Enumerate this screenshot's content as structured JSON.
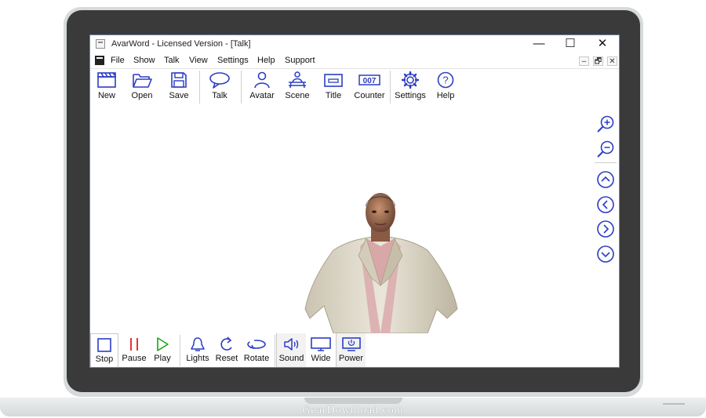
{
  "window": {
    "title": "AvarWord - Licensed Version - [Talk]",
    "controls": {
      "minimize": "—",
      "maximize": "☐",
      "close": "✕"
    },
    "mdi_controls": {
      "minimize": "–",
      "restore": "🗗",
      "close": "✕"
    }
  },
  "menu": [
    "File",
    "Show",
    "Talk",
    "View",
    "Settings",
    "Help",
    "Support"
  ],
  "toolbar": [
    {
      "label": "New",
      "icon": "clapperboard-icon"
    },
    {
      "label": "Open",
      "icon": "folder-open-icon"
    },
    {
      "label": "Save",
      "icon": "floppy-disk-icon"
    },
    {
      "label": "Talk",
      "icon": "speech-bubble-icon"
    },
    {
      "label": "Avatar",
      "icon": "person-icon"
    },
    {
      "label": "Scene",
      "icon": "scene-icon"
    },
    {
      "label": "Title",
      "icon": "title-card-icon"
    },
    {
      "label": "Counter",
      "icon": "counter-icon"
    },
    {
      "label": "Settings",
      "icon": "gear-icon"
    },
    {
      "label": "Help",
      "icon": "question-circle-icon"
    }
  ],
  "nav_controls": [
    "zoom-in-icon",
    "zoom-out-icon",
    "arrow-up-icon",
    "arrow-left-icon",
    "arrow-right-icon",
    "arrow-down-icon"
  ],
  "bottom_toolbar": [
    {
      "label": "Stop",
      "icon": "stop-icon"
    },
    {
      "label": "Pause",
      "icon": "pause-icon"
    },
    {
      "label": "Play",
      "icon": "play-icon"
    },
    {
      "label": "Lights",
      "icon": "bell-light-icon"
    },
    {
      "label": "Reset",
      "icon": "reset-icon"
    },
    {
      "label": "Rotate",
      "icon": "rotate-icon"
    },
    {
      "label": "Sound",
      "icon": "speaker-icon"
    },
    {
      "label": "Wide",
      "icon": "monitor-icon"
    },
    {
      "label": "Power",
      "icon": "power-icon"
    }
  ],
  "colors": {
    "accent": "#2b3dc4",
    "pause": "#e02020",
    "play": "#1aa31a",
    "window_border": "#6a88ad"
  },
  "watermark": "GearDownload.com"
}
